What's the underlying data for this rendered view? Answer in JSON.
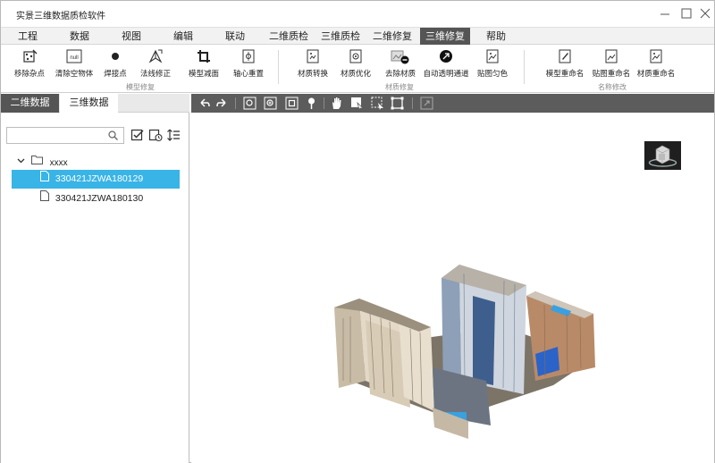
{
  "app": {
    "title": "实景三维数据质检软件"
  },
  "menu": {
    "items": [
      "工程",
      "数据",
      "视图",
      "编辑",
      "联动",
      "二维质检",
      "三维质检",
      "二维修复",
      "三维修复",
      "帮助"
    ],
    "active": "三维修复"
  },
  "ribbon": {
    "model_repair": {
      "group_label": "模型修复",
      "buttons": [
        "移除杂点",
        "清除空物体",
        "焊接点",
        "法线修正",
        "模型减面",
        "轴心重置"
      ]
    },
    "material_repair": {
      "group_label": "材质修复",
      "buttons": [
        "材质转换",
        "材质优化",
        "去除材质",
        "自动透明通道",
        "贴图匀色"
      ]
    },
    "rename": {
      "group_label": "名称修改",
      "buttons": [
        "模型重命名",
        "贴图重命名",
        "材质重命名"
      ]
    }
  },
  "left_panel": {
    "tabs": [
      "二维数据",
      "三维数据"
    ],
    "active_tab": "二维数据",
    "search": {
      "value": "",
      "placeholder": ""
    },
    "tree": {
      "folder": "xxxx",
      "files": [
        "330421JZWA180129",
        "330421JZWA180130"
      ],
      "selected": "330421JZWA180129"
    }
  },
  "colors": {
    "accent": "#39b4e6",
    "tab_dark": "#555555",
    "toolbar": "#5c5c5c"
  },
  "icons": {
    "viewer_toolbar": [
      "undo-icon",
      "redo-icon",
      "zoom-extent-icon",
      "zoom-in-icon",
      "zoom-fit-icon",
      "pin-icon",
      "pan-hand-icon",
      "select-object-icon",
      "box-select-icon",
      "crop-icon",
      "fullscreen-icon"
    ]
  }
}
